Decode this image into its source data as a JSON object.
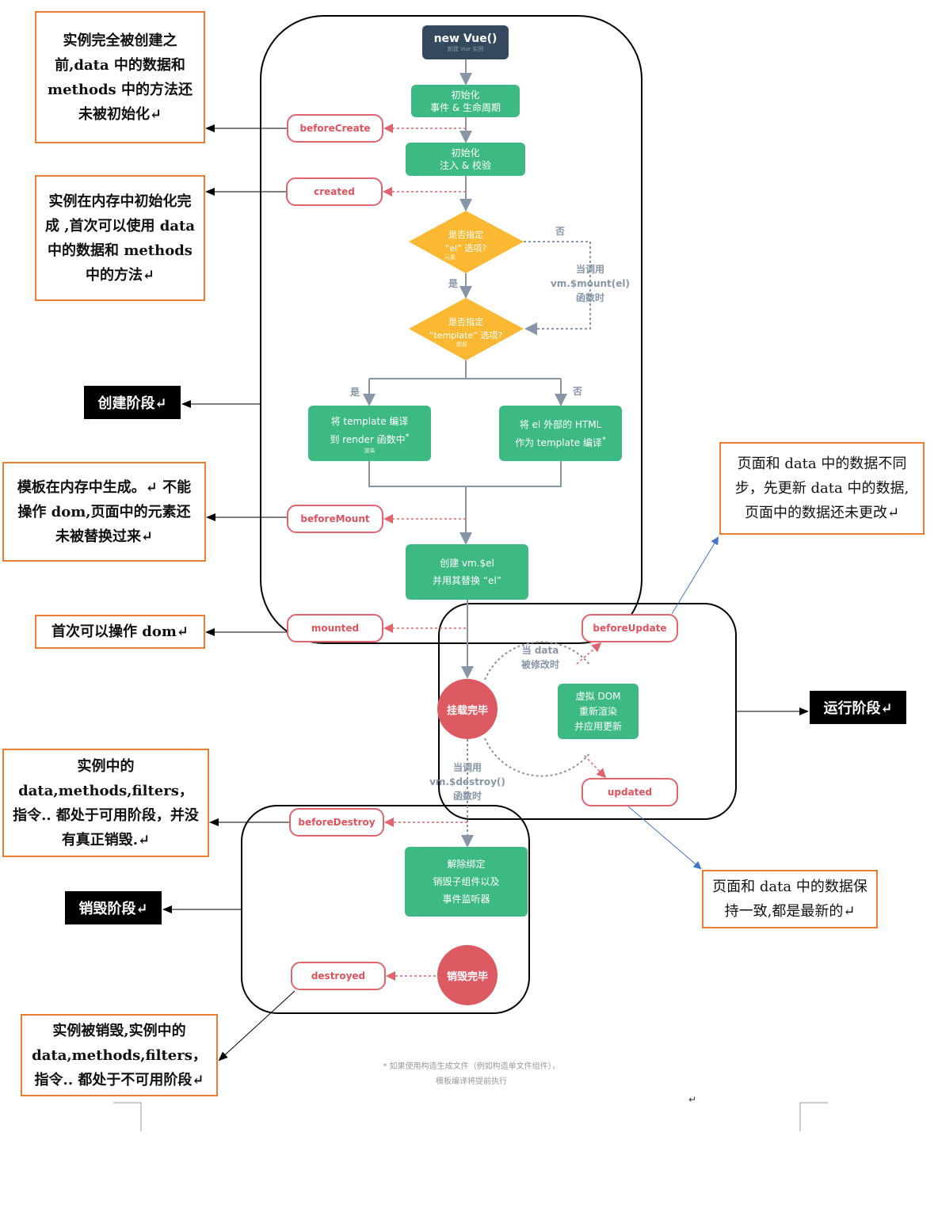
{
  "colors": {
    "green": "#3dba83",
    "dark": "#35495e",
    "hook_red": "#e0646d",
    "diamond": "#fbb833",
    "note_border": "#ed7d31",
    "arrow_blue": "#4472c4"
  },
  "flow": {
    "new_vue": {
      "title": "new Vue()",
      "subtitle": "新建 Vue 实例"
    },
    "init_events": [
      "初始化",
      "事件 & 生命周期"
    ],
    "init_inject": [
      "初始化",
      "注入 & 校验"
    ],
    "diamond_el": {
      "line1": "是否指定",
      "line2": "“el” 选项?",
      "small": "元素"
    },
    "diamond_template": {
      "line1": "是否指定",
      "line2": "“template” 选项?",
      "small": "模板"
    },
    "no_label": "否",
    "yes_label": "是",
    "mount_call": [
      "当调用",
      "vm.$mount(el)",
      "函数时"
    ],
    "branch_yes": "是",
    "branch_no": "否",
    "compile_template": {
      "line1": "将 template 编译",
      "line2": "到 render 函数中",
      "star": "*",
      "small": "渲染"
    },
    "compile_outer": {
      "line1": "将 el 外部的 HTML",
      "line2": "作为 template 编译",
      "star": "*"
    },
    "create_el": [
      "创建 vm.$el",
      "并用其替换 “el”"
    ],
    "mounted_circle": "挂载完毕",
    "data_changed": [
      "当 data",
      "被修改时"
    ],
    "vdom": [
      "虚拟 DOM",
      "重新渲染",
      "并应用更新"
    ],
    "destroy_call": [
      "当调用",
      "vm.$destroy()",
      "函数时"
    ],
    "teardown": [
      "解除绑定",
      "销毁子组件以及",
      "事件监听器"
    ],
    "destroyed_circle": "销毁完毕",
    "footnote": [
      "* 如果使用构造生成文件（例如构造单文件组件），",
      "模板编译将提前执行"
    ]
  },
  "hooks": {
    "beforeCreate": "beforeCreate",
    "created": "created",
    "beforeMount": "beforeMount",
    "mounted": "mounted",
    "beforeUpdate": "beforeUpdate",
    "updated": "updated",
    "beforeDestroy": "beforeDestroy",
    "destroyed": "destroyed"
  },
  "notes": {
    "before_create": "实例完全被创建之前,data 中的数据和 methods 中的方法还未被初始化↵",
    "created": "实例在内存中初始化完成 ,首次可以使用 data 中的数据和 methods 中的方法↵",
    "before_mount": "模板在内存中生成。↵ 不能操作 dom,页面中的元素还未被替换过来↵",
    "mounted": "首次可以操作 dom↵",
    "before_destroy": "实例中的 data,methods,filters，指令.. 都处于可用阶段，并没有真正销毁.↵",
    "destroyed": "实例被销毁,实例中的 data,methods,filters，指令.. 都处于不可用阶段↵",
    "before_update": "页面和 data 中的数据不同步，先更新 data 中的数据,页面中的数据还未更改↵",
    "updated": "页面和 data 中的数据保持一致,都是最新的↵"
  },
  "stages": {
    "create": "创建阶段↵",
    "run": "运行阶段↵",
    "destroy": "销毁阶段↵"
  },
  "cursor_mark": "↵"
}
